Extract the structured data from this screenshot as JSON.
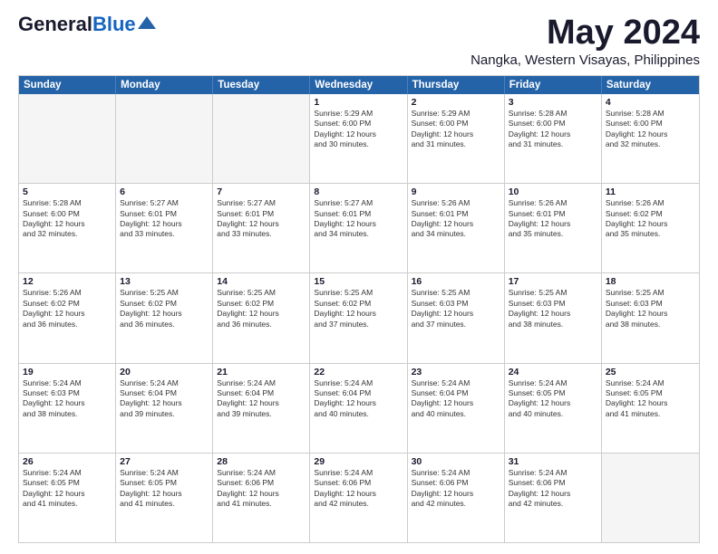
{
  "header": {
    "logo_general": "General",
    "logo_blue": "Blue",
    "month_title": "May 2024",
    "subtitle": "Nangka, Western Visayas, Philippines"
  },
  "weekdays": [
    "Sunday",
    "Monday",
    "Tuesday",
    "Wednesday",
    "Thursday",
    "Friday",
    "Saturday"
  ],
  "rows": [
    [
      {
        "day": "",
        "text": ""
      },
      {
        "day": "",
        "text": ""
      },
      {
        "day": "",
        "text": ""
      },
      {
        "day": "1",
        "text": "Sunrise: 5:29 AM\nSunset: 6:00 PM\nDaylight: 12 hours\nand 30 minutes."
      },
      {
        "day": "2",
        "text": "Sunrise: 5:29 AM\nSunset: 6:00 PM\nDaylight: 12 hours\nand 31 minutes."
      },
      {
        "day": "3",
        "text": "Sunrise: 5:28 AM\nSunset: 6:00 PM\nDaylight: 12 hours\nand 31 minutes."
      },
      {
        "day": "4",
        "text": "Sunrise: 5:28 AM\nSunset: 6:00 PM\nDaylight: 12 hours\nand 32 minutes."
      }
    ],
    [
      {
        "day": "5",
        "text": "Sunrise: 5:28 AM\nSunset: 6:00 PM\nDaylight: 12 hours\nand 32 minutes."
      },
      {
        "day": "6",
        "text": "Sunrise: 5:27 AM\nSunset: 6:01 PM\nDaylight: 12 hours\nand 33 minutes."
      },
      {
        "day": "7",
        "text": "Sunrise: 5:27 AM\nSunset: 6:01 PM\nDaylight: 12 hours\nand 33 minutes."
      },
      {
        "day": "8",
        "text": "Sunrise: 5:27 AM\nSunset: 6:01 PM\nDaylight: 12 hours\nand 34 minutes."
      },
      {
        "day": "9",
        "text": "Sunrise: 5:26 AM\nSunset: 6:01 PM\nDaylight: 12 hours\nand 34 minutes."
      },
      {
        "day": "10",
        "text": "Sunrise: 5:26 AM\nSunset: 6:01 PM\nDaylight: 12 hours\nand 35 minutes."
      },
      {
        "day": "11",
        "text": "Sunrise: 5:26 AM\nSunset: 6:02 PM\nDaylight: 12 hours\nand 35 minutes."
      }
    ],
    [
      {
        "day": "12",
        "text": "Sunrise: 5:26 AM\nSunset: 6:02 PM\nDaylight: 12 hours\nand 36 minutes."
      },
      {
        "day": "13",
        "text": "Sunrise: 5:25 AM\nSunset: 6:02 PM\nDaylight: 12 hours\nand 36 minutes."
      },
      {
        "day": "14",
        "text": "Sunrise: 5:25 AM\nSunset: 6:02 PM\nDaylight: 12 hours\nand 36 minutes."
      },
      {
        "day": "15",
        "text": "Sunrise: 5:25 AM\nSunset: 6:02 PM\nDaylight: 12 hours\nand 37 minutes."
      },
      {
        "day": "16",
        "text": "Sunrise: 5:25 AM\nSunset: 6:03 PM\nDaylight: 12 hours\nand 37 minutes."
      },
      {
        "day": "17",
        "text": "Sunrise: 5:25 AM\nSunset: 6:03 PM\nDaylight: 12 hours\nand 38 minutes."
      },
      {
        "day": "18",
        "text": "Sunrise: 5:25 AM\nSunset: 6:03 PM\nDaylight: 12 hours\nand 38 minutes."
      }
    ],
    [
      {
        "day": "19",
        "text": "Sunrise: 5:24 AM\nSunset: 6:03 PM\nDaylight: 12 hours\nand 38 minutes."
      },
      {
        "day": "20",
        "text": "Sunrise: 5:24 AM\nSunset: 6:04 PM\nDaylight: 12 hours\nand 39 minutes."
      },
      {
        "day": "21",
        "text": "Sunrise: 5:24 AM\nSunset: 6:04 PM\nDaylight: 12 hours\nand 39 minutes."
      },
      {
        "day": "22",
        "text": "Sunrise: 5:24 AM\nSunset: 6:04 PM\nDaylight: 12 hours\nand 40 minutes."
      },
      {
        "day": "23",
        "text": "Sunrise: 5:24 AM\nSunset: 6:04 PM\nDaylight: 12 hours\nand 40 minutes."
      },
      {
        "day": "24",
        "text": "Sunrise: 5:24 AM\nSunset: 6:05 PM\nDaylight: 12 hours\nand 40 minutes."
      },
      {
        "day": "25",
        "text": "Sunrise: 5:24 AM\nSunset: 6:05 PM\nDaylight: 12 hours\nand 41 minutes."
      }
    ],
    [
      {
        "day": "26",
        "text": "Sunrise: 5:24 AM\nSunset: 6:05 PM\nDaylight: 12 hours\nand 41 minutes."
      },
      {
        "day": "27",
        "text": "Sunrise: 5:24 AM\nSunset: 6:05 PM\nDaylight: 12 hours\nand 41 minutes."
      },
      {
        "day": "28",
        "text": "Sunrise: 5:24 AM\nSunset: 6:06 PM\nDaylight: 12 hours\nand 41 minutes."
      },
      {
        "day": "29",
        "text": "Sunrise: 5:24 AM\nSunset: 6:06 PM\nDaylight: 12 hours\nand 42 minutes."
      },
      {
        "day": "30",
        "text": "Sunrise: 5:24 AM\nSunset: 6:06 PM\nDaylight: 12 hours\nand 42 minutes."
      },
      {
        "day": "31",
        "text": "Sunrise: 5:24 AM\nSunset: 6:06 PM\nDaylight: 12 hours\nand 42 minutes."
      },
      {
        "day": "",
        "text": ""
      }
    ]
  ]
}
